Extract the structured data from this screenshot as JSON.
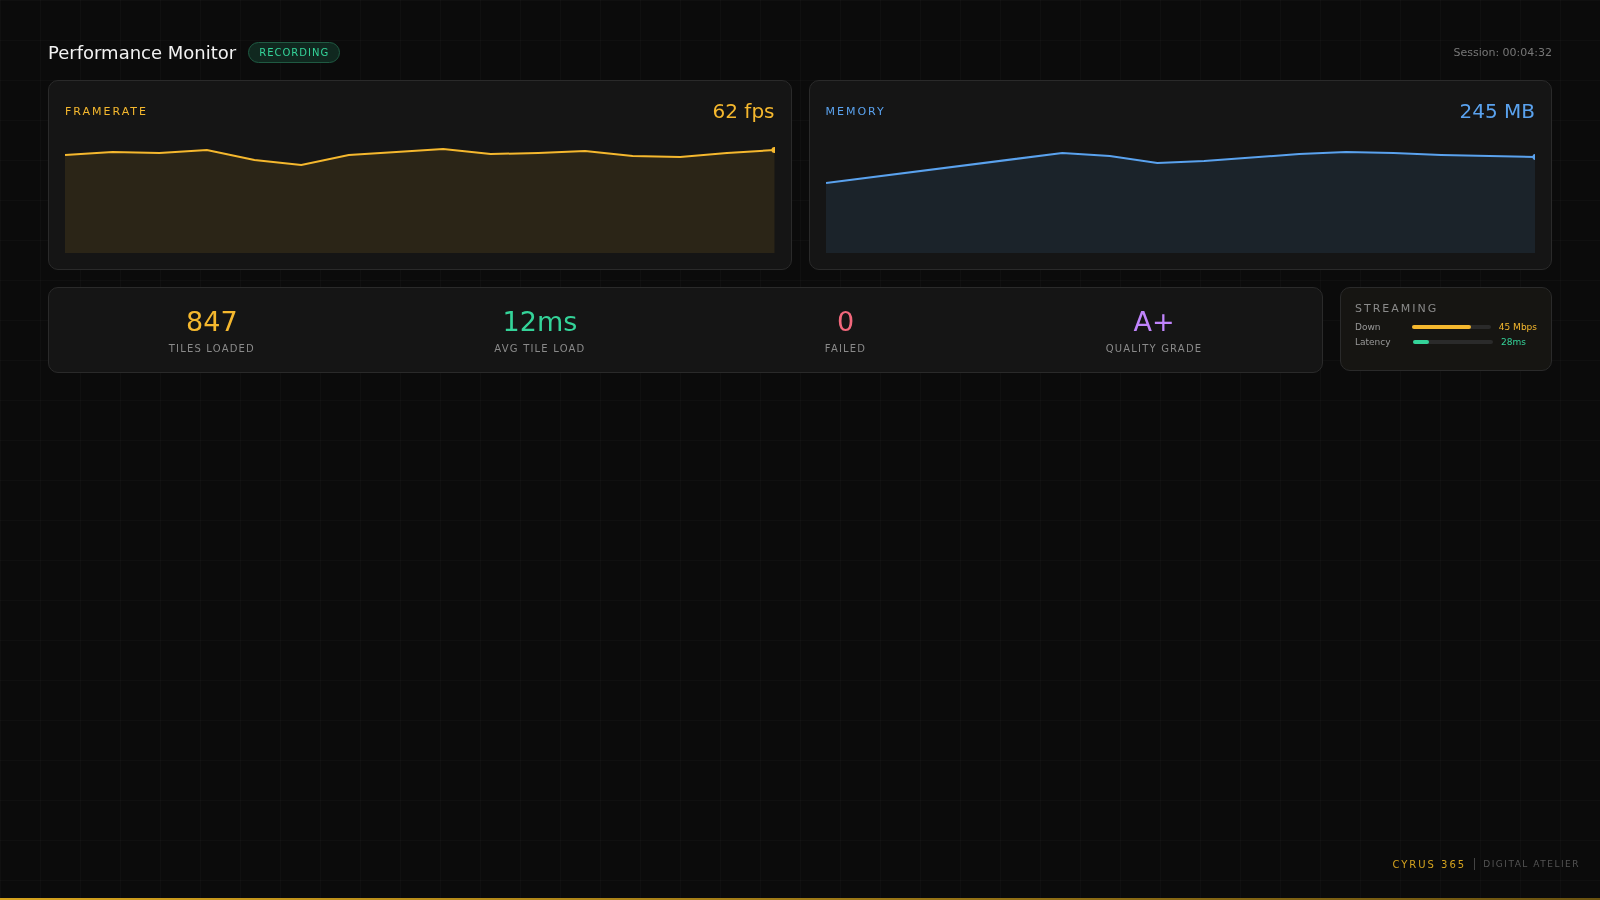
{
  "header": {
    "title": "Performance Monitor",
    "badge": "RECORDING",
    "session": "Session: 00:04:32"
  },
  "charts": [
    {
      "kind": "framerate",
      "label": "FRAMERATE",
      "value": "62 fps",
      "color": "#f5b82e"
    },
    {
      "kind": "memory",
      "label": "MEMORY",
      "value": "245 MB",
      "color": "#5aa2ee"
    }
  ],
  "stats": [
    {
      "value": "847",
      "label": "TILES LOADED",
      "color": "#f5b82e"
    },
    {
      "value": "12ms",
      "label": "AVG TILE LOAD",
      "color": "#34d399"
    },
    {
      "value": "0",
      "label": "FAILED",
      "color": "#f2687c"
    },
    {
      "value": "A+",
      "label": "QUALITY GRADE",
      "color": "#c084fc"
    }
  ],
  "streaming": {
    "title": "STREAMING",
    "rows": [
      {
        "label": "Down",
        "level": 0.75,
        "reading": "45 Mbps",
        "color": "#f5b82e"
      },
      {
        "label": "Latency",
        "level": 0.2,
        "reading": "28ms",
        "color": "#34d399"
      }
    ]
  },
  "footer": {
    "brand": "CYRUS 365",
    "tagline": "DIGITAL ATELIER"
  }
}
